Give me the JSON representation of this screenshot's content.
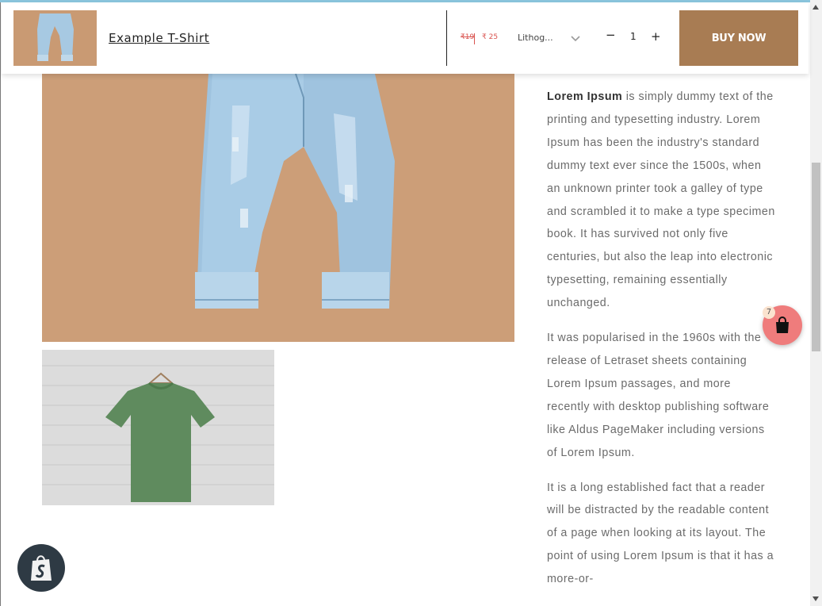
{
  "sticky_bar": {
    "product_title": "Example T-Shirt",
    "price_original": "₹19",
    "price_sale": "₹ 25",
    "variant_value": "Lithog...",
    "quantity": "1",
    "minus_label": "−",
    "plus_label": "+",
    "buy_now_label": "BUY NOW"
  },
  "description": {
    "p1_bold": "Lorem Ipsum",
    "p1_rest": " is simply dummy text of the printing and typesetting industry. Lorem Ipsum has been the industry's standard dummy text ever since the 1500s, when an unknown printer took a galley of type and scrambled it to make a type specimen book. It has survived not only five centuries, but also the leap into electronic typesetting, remaining essentially unchanged.",
    "p2": "It was popularised in the 1960s with the release of Letraset sheets containing Lorem Ipsum passages, and more recently with desktop publishing software like Aldus PageMaker including versions of Lorem Ipsum.",
    "p3": "It is a long established fact that a reader will be distracted by the readable content of a page when looking at its layout. The point of using Lorem Ipsum is that it has a more-or-"
  },
  "cart": {
    "count": "7"
  },
  "icons": {
    "chevron": "chevron-down-icon",
    "bag": "shopping-bag-icon",
    "shopify": "shopify-bag-icon"
  },
  "colors": {
    "buy_button": "#a87c53",
    "price": "#d9534f",
    "cart_fab": "#ef7c7c",
    "accent": "#8ac5dd"
  }
}
